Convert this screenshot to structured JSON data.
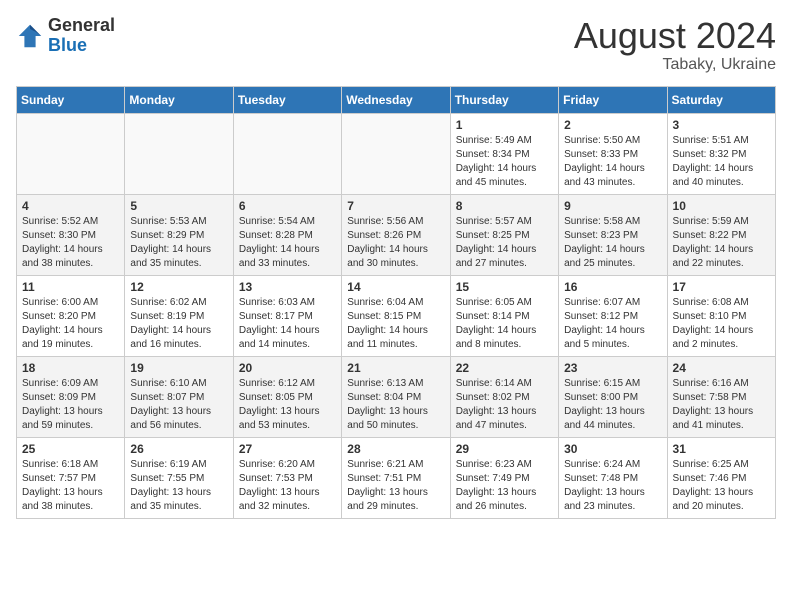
{
  "header": {
    "title": "August 2024",
    "location": "Tabaky, Ukraine",
    "logo_line1": "General",
    "logo_line2": "Blue"
  },
  "days_of_week": [
    "Sunday",
    "Monday",
    "Tuesday",
    "Wednesday",
    "Thursday",
    "Friday",
    "Saturday"
  ],
  "weeks": [
    [
      {
        "day": "",
        "info": ""
      },
      {
        "day": "",
        "info": ""
      },
      {
        "day": "",
        "info": ""
      },
      {
        "day": "",
        "info": ""
      },
      {
        "day": "1",
        "info": "Sunrise: 5:49 AM\nSunset: 8:34 PM\nDaylight: 14 hours and 45 minutes."
      },
      {
        "day": "2",
        "info": "Sunrise: 5:50 AM\nSunset: 8:33 PM\nDaylight: 14 hours and 43 minutes."
      },
      {
        "day": "3",
        "info": "Sunrise: 5:51 AM\nSunset: 8:32 PM\nDaylight: 14 hours and 40 minutes."
      }
    ],
    [
      {
        "day": "4",
        "info": "Sunrise: 5:52 AM\nSunset: 8:30 PM\nDaylight: 14 hours and 38 minutes."
      },
      {
        "day": "5",
        "info": "Sunrise: 5:53 AM\nSunset: 8:29 PM\nDaylight: 14 hours and 35 minutes."
      },
      {
        "day": "6",
        "info": "Sunrise: 5:54 AM\nSunset: 8:28 PM\nDaylight: 14 hours and 33 minutes."
      },
      {
        "day": "7",
        "info": "Sunrise: 5:56 AM\nSunset: 8:26 PM\nDaylight: 14 hours and 30 minutes."
      },
      {
        "day": "8",
        "info": "Sunrise: 5:57 AM\nSunset: 8:25 PM\nDaylight: 14 hours and 27 minutes."
      },
      {
        "day": "9",
        "info": "Sunrise: 5:58 AM\nSunset: 8:23 PM\nDaylight: 14 hours and 25 minutes."
      },
      {
        "day": "10",
        "info": "Sunrise: 5:59 AM\nSunset: 8:22 PM\nDaylight: 14 hours and 22 minutes."
      }
    ],
    [
      {
        "day": "11",
        "info": "Sunrise: 6:00 AM\nSunset: 8:20 PM\nDaylight: 14 hours and 19 minutes."
      },
      {
        "day": "12",
        "info": "Sunrise: 6:02 AM\nSunset: 8:19 PM\nDaylight: 14 hours and 16 minutes."
      },
      {
        "day": "13",
        "info": "Sunrise: 6:03 AM\nSunset: 8:17 PM\nDaylight: 14 hours and 14 minutes."
      },
      {
        "day": "14",
        "info": "Sunrise: 6:04 AM\nSunset: 8:15 PM\nDaylight: 14 hours and 11 minutes."
      },
      {
        "day": "15",
        "info": "Sunrise: 6:05 AM\nSunset: 8:14 PM\nDaylight: 14 hours and 8 minutes."
      },
      {
        "day": "16",
        "info": "Sunrise: 6:07 AM\nSunset: 8:12 PM\nDaylight: 14 hours and 5 minutes."
      },
      {
        "day": "17",
        "info": "Sunrise: 6:08 AM\nSunset: 8:10 PM\nDaylight: 14 hours and 2 minutes."
      }
    ],
    [
      {
        "day": "18",
        "info": "Sunrise: 6:09 AM\nSunset: 8:09 PM\nDaylight: 13 hours and 59 minutes."
      },
      {
        "day": "19",
        "info": "Sunrise: 6:10 AM\nSunset: 8:07 PM\nDaylight: 13 hours and 56 minutes."
      },
      {
        "day": "20",
        "info": "Sunrise: 6:12 AM\nSunset: 8:05 PM\nDaylight: 13 hours and 53 minutes."
      },
      {
        "day": "21",
        "info": "Sunrise: 6:13 AM\nSunset: 8:04 PM\nDaylight: 13 hours and 50 minutes."
      },
      {
        "day": "22",
        "info": "Sunrise: 6:14 AM\nSunset: 8:02 PM\nDaylight: 13 hours and 47 minutes."
      },
      {
        "day": "23",
        "info": "Sunrise: 6:15 AM\nSunset: 8:00 PM\nDaylight: 13 hours and 44 minutes."
      },
      {
        "day": "24",
        "info": "Sunrise: 6:16 AM\nSunset: 7:58 PM\nDaylight: 13 hours and 41 minutes."
      }
    ],
    [
      {
        "day": "25",
        "info": "Sunrise: 6:18 AM\nSunset: 7:57 PM\nDaylight: 13 hours and 38 minutes."
      },
      {
        "day": "26",
        "info": "Sunrise: 6:19 AM\nSunset: 7:55 PM\nDaylight: 13 hours and 35 minutes."
      },
      {
        "day": "27",
        "info": "Sunrise: 6:20 AM\nSunset: 7:53 PM\nDaylight: 13 hours and 32 minutes."
      },
      {
        "day": "28",
        "info": "Sunrise: 6:21 AM\nSunset: 7:51 PM\nDaylight: 13 hours and 29 minutes."
      },
      {
        "day": "29",
        "info": "Sunrise: 6:23 AM\nSunset: 7:49 PM\nDaylight: 13 hours and 26 minutes."
      },
      {
        "day": "30",
        "info": "Sunrise: 6:24 AM\nSunset: 7:48 PM\nDaylight: 13 hours and 23 minutes."
      },
      {
        "day": "31",
        "info": "Sunrise: 6:25 AM\nSunset: 7:46 PM\nDaylight: 13 hours and 20 minutes."
      }
    ]
  ]
}
